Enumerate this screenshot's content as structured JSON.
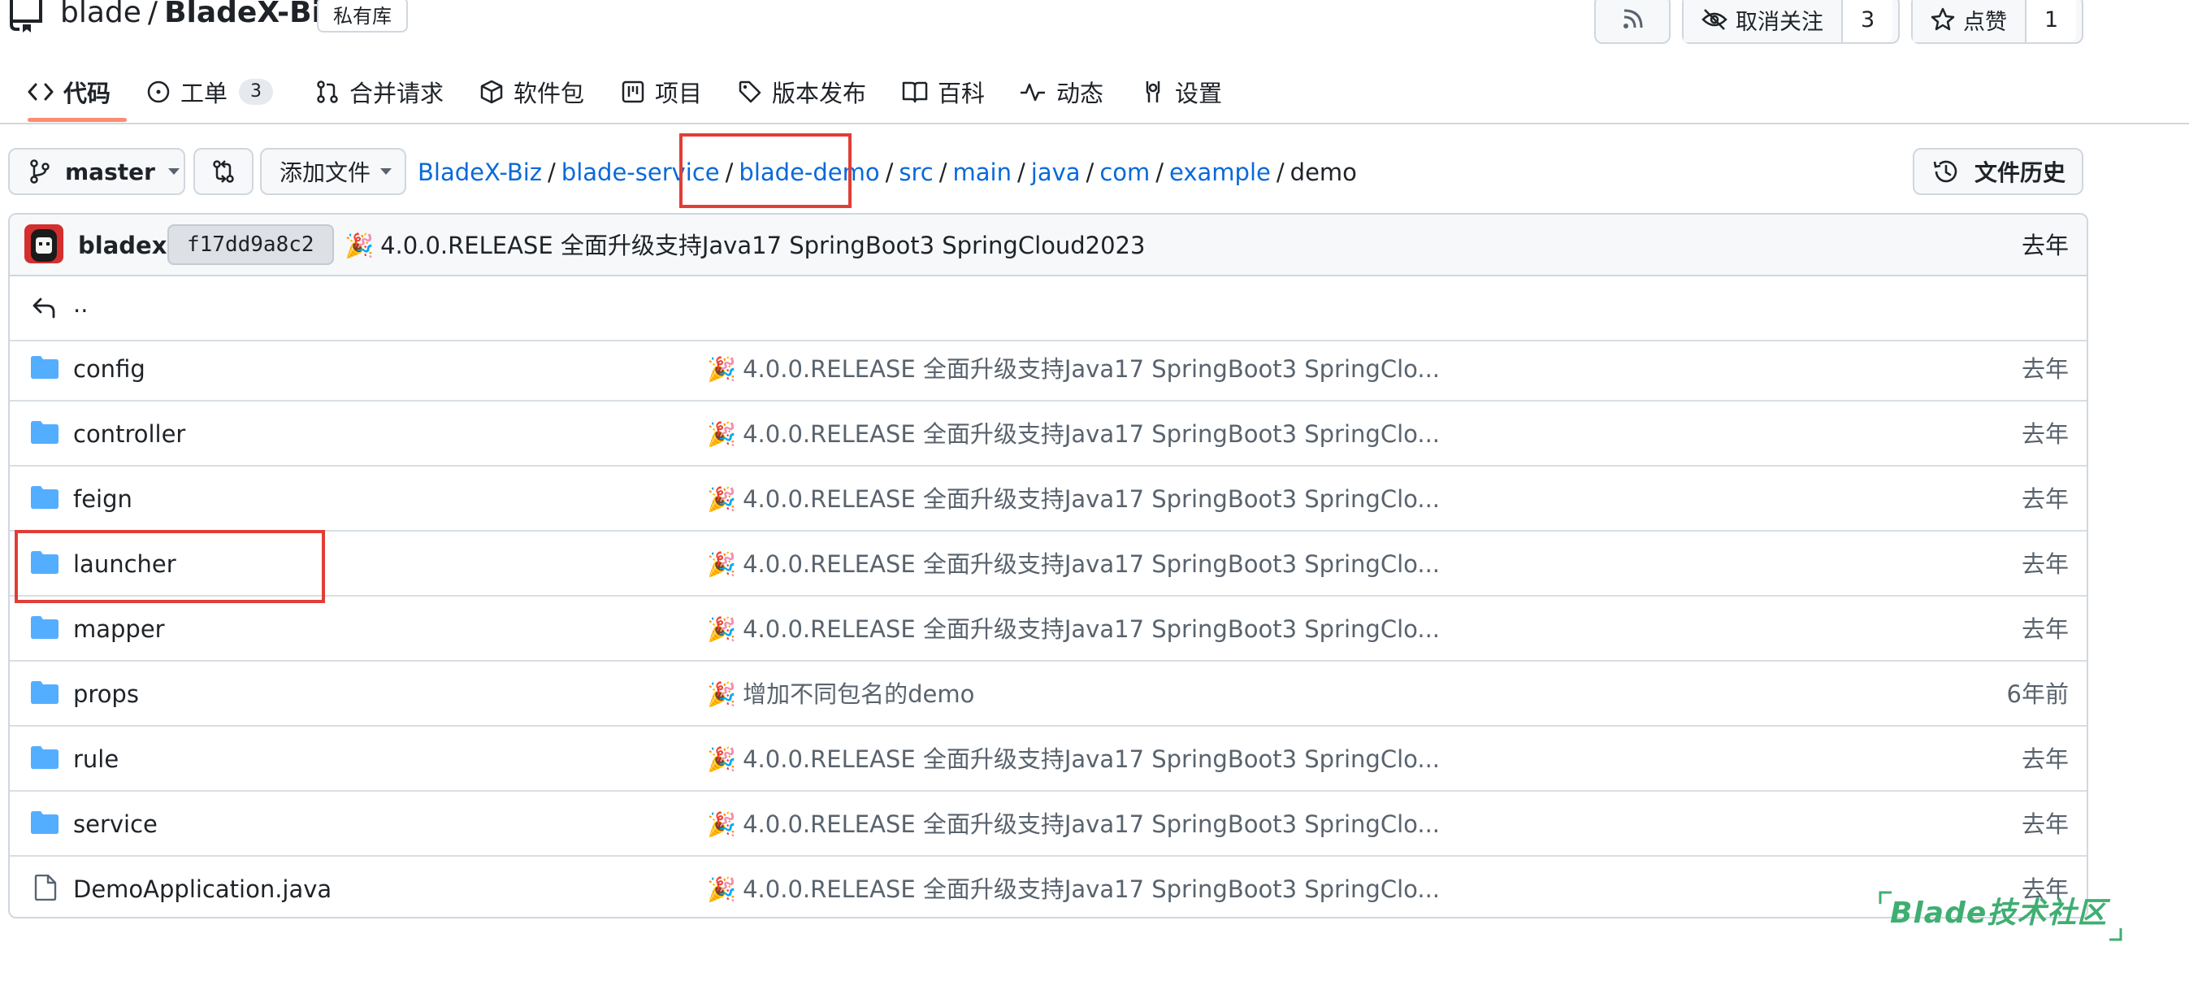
{
  "header": {
    "owner": "blade",
    "separator": "/",
    "repo": "BladeX-Biz",
    "private_badge": "私有库",
    "watch_label": "取消关注",
    "watch_count": "3",
    "star_label": "点赞",
    "star_count": "1"
  },
  "nav": {
    "tabs": [
      {
        "label": "代码",
        "icon": "code-icon"
      },
      {
        "label": "工单",
        "icon": "issue-icon",
        "count": "3"
      },
      {
        "label": "合并请求",
        "icon": "pull-request-icon"
      },
      {
        "label": "软件包",
        "icon": "package-icon"
      },
      {
        "label": "项目",
        "icon": "project-icon"
      },
      {
        "label": "版本发布",
        "icon": "tag-icon"
      },
      {
        "label": "百科",
        "icon": "book-icon"
      },
      {
        "label": "动态",
        "icon": "pulse-icon"
      },
      {
        "label": "设置",
        "icon": "settings-icon"
      }
    ]
  },
  "toolbar": {
    "branch": "master",
    "add_file": "添加文件",
    "history": "文件历史"
  },
  "breadcrumb": {
    "parts": [
      "BladeX-Biz",
      "blade-service",
      "blade-demo",
      "src",
      "main",
      "java",
      "com",
      "example"
    ],
    "current": "demo",
    "separator": "/"
  },
  "commit": {
    "author": "bladex",
    "sha": "f17dd9a8c2",
    "emoji": "🎉",
    "message": "4.0.0.RELEASE 全面升级支持Java17 SpringBoot3 SpringCloud2023",
    "time": "去年"
  },
  "parent_dir": "..",
  "files": [
    {
      "name": "config",
      "type": "folder",
      "message": "4.0.0.RELEASE 全面升级支持Java17 SpringBoot3 SpringClo...",
      "time": "去年"
    },
    {
      "name": "controller",
      "type": "folder",
      "message": "4.0.0.RELEASE 全面升级支持Java17 SpringBoot3 SpringClo...",
      "time": "去年"
    },
    {
      "name": "feign",
      "type": "folder",
      "message": "4.0.0.RELEASE 全面升级支持Java17 SpringBoot3 SpringClo...",
      "time": "去年"
    },
    {
      "name": "launcher",
      "type": "folder",
      "message": "4.0.0.RELEASE 全面升级支持Java17 SpringBoot3 SpringClo...",
      "time": "去年"
    },
    {
      "name": "mapper",
      "type": "folder",
      "message": "4.0.0.RELEASE 全面升级支持Java17 SpringBoot3 SpringClo...",
      "time": "去年"
    },
    {
      "name": "props",
      "type": "folder",
      "message": "增加不同包名的demo",
      "time": "6年前"
    },
    {
      "name": "rule",
      "type": "folder",
      "message": "4.0.0.RELEASE 全面升级支持Java17 SpringBoot3 SpringClo...",
      "time": "去年"
    },
    {
      "name": "service",
      "type": "folder",
      "message": "4.0.0.RELEASE 全面升级支持Java17 SpringBoot3 SpringClo...",
      "time": "去年"
    },
    {
      "name": "DemoApplication.java",
      "type": "file",
      "message": "4.0.0.RELEASE 全面升级支持Java17 SpringBoot3 SpringClo...",
      "time": "去年"
    }
  ],
  "watermark": "Blade技术社区",
  "colors": {
    "link": "#0969da",
    "folder": "#54aeff",
    "highlight_box": "#e03e36",
    "tab_underline": "#fd8c73",
    "watermark": "#3fae72"
  }
}
